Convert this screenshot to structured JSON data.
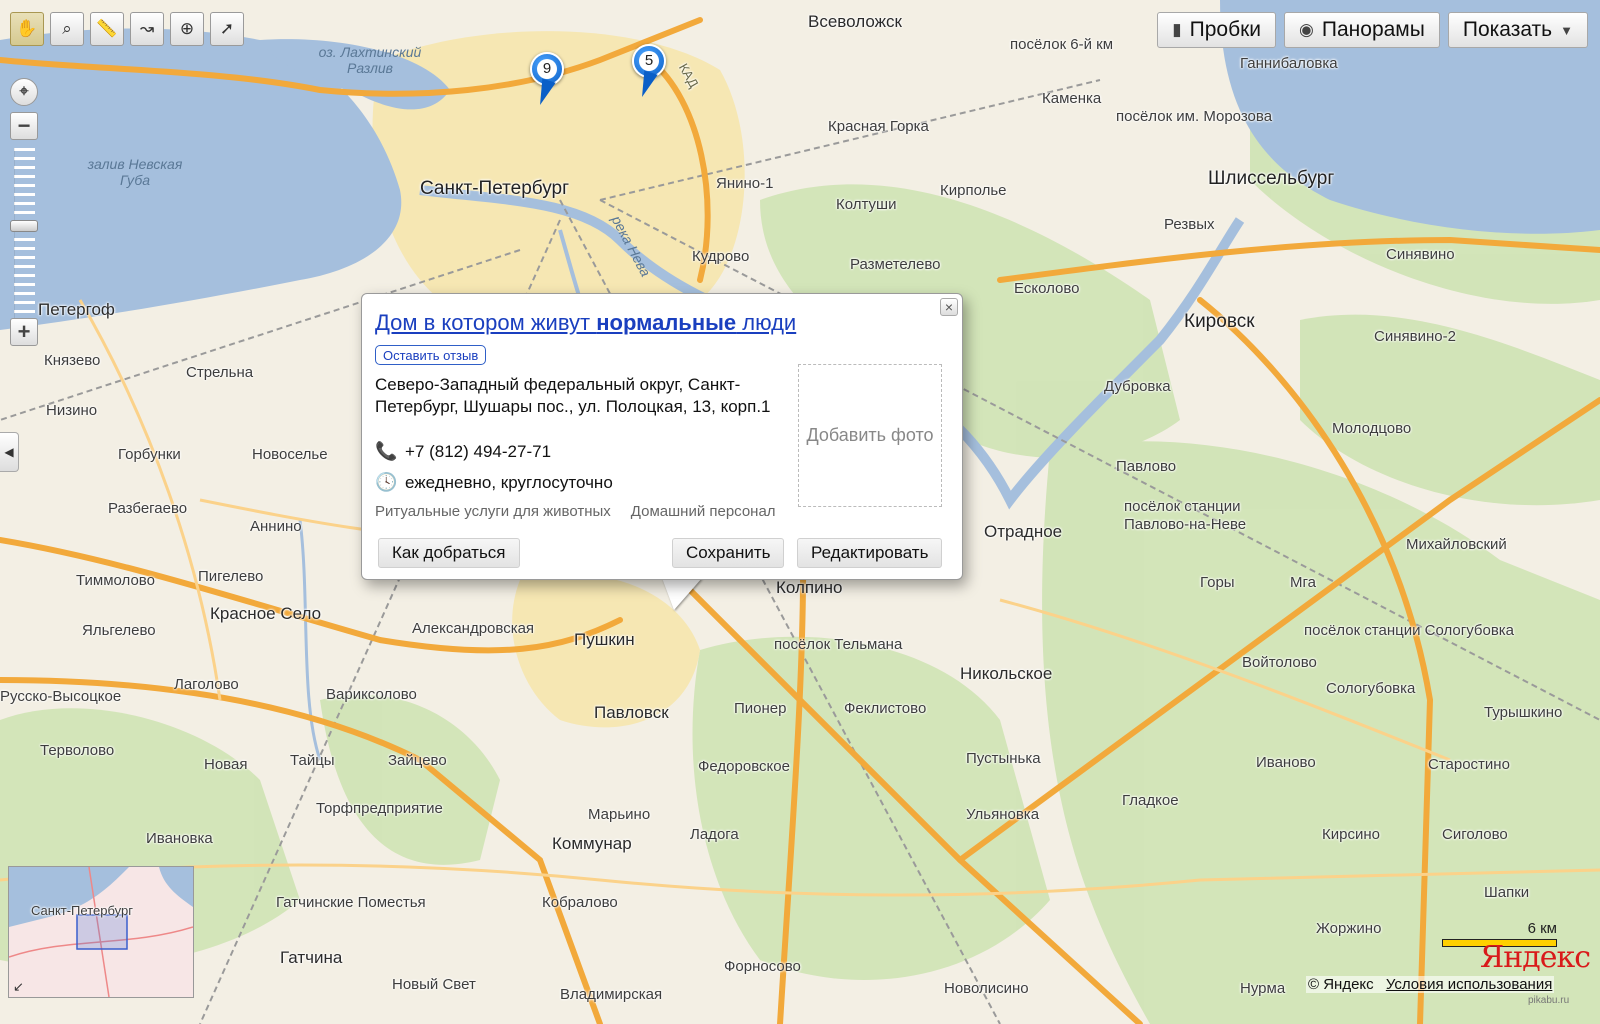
{
  "toolbar": {
    "tools": [
      {
        "icon": "hand-icon",
        "glyph": "✋"
      },
      {
        "icon": "magnifier-zoom-icon",
        "glyph": "⌕"
      },
      {
        "icon": "ruler-icon",
        "glyph": "📏"
      },
      {
        "icon": "route-icon",
        "glyph": "↝"
      },
      {
        "icon": "add-object-icon",
        "glyph": "⊕"
      },
      {
        "icon": "cursor-info-icon",
        "glyph": "➚"
      }
    ]
  },
  "zoom": {
    "minus": "−",
    "plus": "+"
  },
  "top_buttons": {
    "traffic": {
      "icon": "traffic-light-icon",
      "glyph": "▮",
      "label": "Пробки"
    },
    "panoramas": {
      "icon": "panorama-icon",
      "glyph": "◉",
      "label": "Панорамы"
    },
    "show": {
      "label": "Показать",
      "arrow": "▼"
    }
  },
  "markers": [
    {
      "number": "9"
    },
    {
      "number": "5"
    }
  ],
  "popup": {
    "title_part1": "Дом в котором живут ",
    "title_bold": "нормальные",
    "title_part2": " люди",
    "review_button": "Оставить отзыв",
    "address": "Северо-Западный федеральный округ, Санкт-Петербург, Шушары пос., ул. Полоцкая, 13, корп.1",
    "phone": "+7 (812) 494-27-71",
    "hours": "ежедневно, круглосуточно",
    "categories": [
      "Ритуальные услуги для животных",
      "Домашний персонал"
    ],
    "add_photo": "Добавить фото",
    "buttons": {
      "directions": "Как добраться",
      "save": "Сохранить",
      "edit": "Редактировать"
    },
    "close": "×"
  },
  "places": {
    "vsevolozhsk": "Всеволожск",
    "spb": "Санкт-Петербург",
    "shlisselburg": "Шлиссельбург",
    "kirovsk": "Кировск",
    "peterhof": "Петергоф",
    "otradnoe": "Отрадное",
    "kolpino": "Колпино",
    "pushkin": "Пушкин",
    "pavlovsk": "Павловск",
    "krasnoe_selo": "Красное Село",
    "nikolskoe": "Никольское",
    "kommunar": "Коммунар",
    "gatchina": "Гатчина",
    "posyolok6": "посёлок 6-й км",
    "gannibalovka": "Ганнибаловка",
    "kamenka": "Каменка",
    "morozova": "посёлок им. Морозова",
    "krasnaya_gorka": "Красная Горка",
    "yanino": "Янино-1",
    "kirpolye": "Кирполье",
    "koltushi": "Колтуши",
    "rezvykh": "Резвых",
    "sinyavino": "Синявино",
    "razmetelevo": "Разметелево",
    "kudrovo": "Кудрово",
    "eskolovo": "Есколово",
    "sinyavino2": "Синявино-2",
    "dubrovka": "Дубровка",
    "molodtsovo": "Молодцово",
    "knyazevo": "Князево",
    "strelna": "Стрельна",
    "nizino": "Низино",
    "gorbunki": "Горбунки",
    "novoselye": "Новоселье",
    "razbegaevo": "Разбегаево",
    "annino": "Аннино",
    "timmolovo": "Тиммолово",
    "pigelevo": "Пигелево",
    "yalgelevo": "Яльгелево",
    "aleksandrovskaya": "Александровская",
    "pavlovo": "Павлово",
    "pavlovo_neve": "посёлок станции Павлово-на-Неве",
    "mikhailovsky": "Михайловский",
    "gory": "Горы",
    "mga": "Мга",
    "telmana": "посёлок Тельмана",
    "sologubovka_st": "посёлок станции Сологубовка",
    "voytolovo": "Войтолово",
    "sologubovka": "Сологубовка",
    "turyshkino": "Турышкино",
    "lagolovo": "Лаголово",
    "variksolovo": "Вариксолово",
    "pioner": "Пионер",
    "feklistovo": "Феклистово",
    "vysotskoe": "Русско-Высоцкое",
    "tervolovo": "Терволово",
    "novaya": "Новая",
    "taytsy": "Тайцы",
    "zaytsevo": "Зайцево",
    "fedorovskoe": "Федоровское",
    "pustynka": "Пустынька",
    "ivanovo": "Иваново",
    "starostino": "Старостино",
    "torfpred": "Торфпредприятие",
    "marino": "Марьино",
    "ulyanovka": "Ульяновка",
    "gladkoe": "Гладкое",
    "ivanovka": "Ивановка",
    "ladoga": "Ладога",
    "kirsino": "Кирсино",
    "sigolovo": "Сиголово",
    "gatch_pomestya": "Гатчинские Поместья",
    "kobralovo": "Кобралово",
    "shapki": "Шапки",
    "zhorzhino": "Жоржино",
    "fornosovo": "Форносово",
    "novy_svet": "Новый Свет",
    "vladimirskaya": "Владимирская",
    "novolisino": "Новолисино",
    "nurma": "Нурма",
    "lakhta": "оз. Лахтинский Разлив",
    "neva_bay": "залив Невская Губа",
    "reka_neva": "река Нева",
    "kad": "КАД"
  },
  "minimap": {
    "city": "Санкт-Петербург"
  },
  "scale": {
    "label": "6 км"
  },
  "logo": "Яндекс",
  "footer": {
    "copyright": "© Яндекс",
    "terms": "Условия использования"
  },
  "credit": "pikabu.ru",
  "colors": {
    "water": "#a5bfdd",
    "land": "#f3efe4",
    "forest": "#cfe3b4",
    "road": "#f2a93b",
    "urban": "#f6e7b3",
    "accent": "#1a3fbf"
  }
}
